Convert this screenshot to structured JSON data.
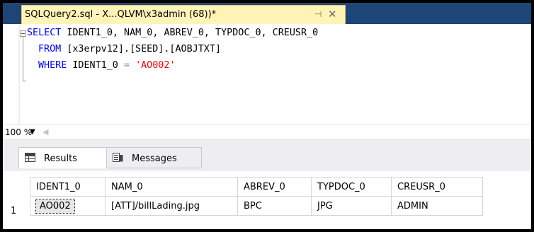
{
  "tab": {
    "title": "SQLQuery2.sql - X...QLVM\\x3admin (68))*",
    "pin": "⊣",
    "close": "✕"
  },
  "editor": {
    "line1": {
      "kw": "SELECT",
      "rest": " IDENT1_0, NAM_0, ABREV_0, TYPDOC_0, CREUSR_0"
    },
    "line2": {
      "kw": "FROM",
      "rest": " [x3erpv12].[SEED].[AOBJTXT]"
    },
    "line3": {
      "kw": "WHERE",
      "rest": " IDENT1_0 ",
      "op": "=",
      "str": "'AO002'"
    }
  },
  "zoom": {
    "value": "100 %"
  },
  "results_tabs": [
    {
      "label": "Results"
    },
    {
      "label": "Messages"
    }
  ],
  "grid": {
    "columns": [
      "IDENT1_0",
      "NAM_0",
      "ABREV_0",
      "TYPDOC_0",
      "CREUSR_0"
    ],
    "rows": [
      {
        "num": "1",
        "cells": [
          "AO002",
          "[ATT]/billLading.jpg",
          "BPC",
          "JPG",
          "ADMIN"
        ]
      }
    ]
  }
}
